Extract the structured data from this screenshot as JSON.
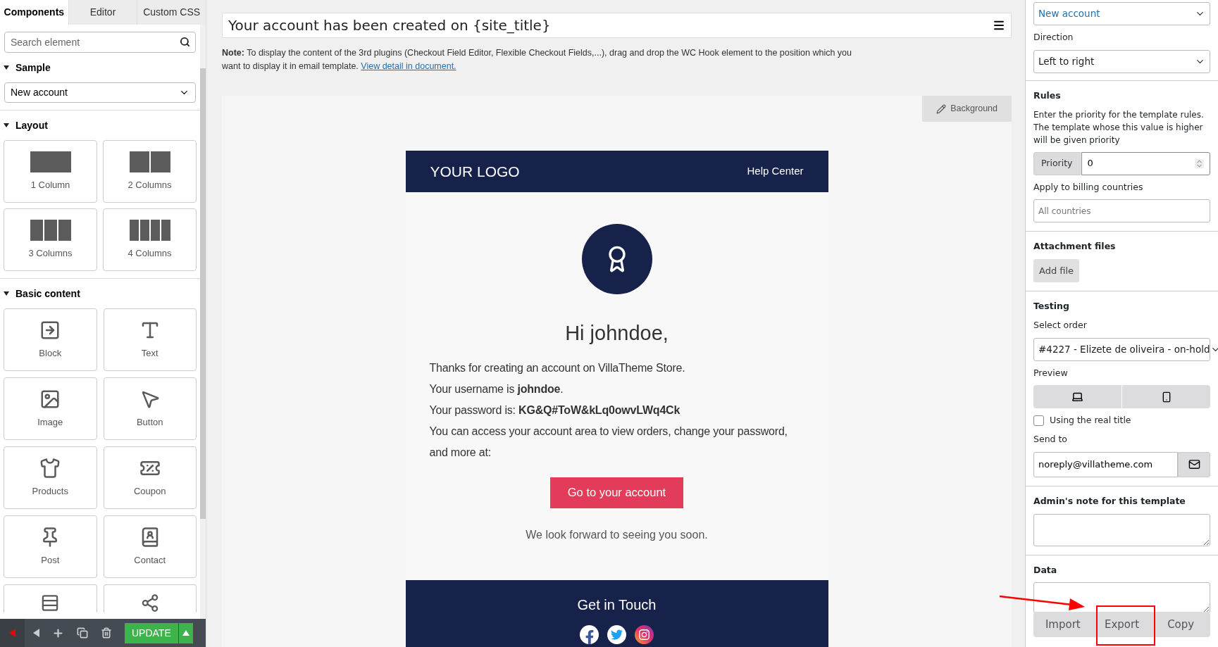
{
  "left_panel": {
    "tabs": [
      {
        "label": "Components",
        "selected": true
      },
      {
        "label": "Editor",
        "selected": false
      },
      {
        "label": "Custom CSS",
        "selected": false
      }
    ],
    "search": {
      "placeholder": "Search element"
    },
    "sample": {
      "heading": "Sample",
      "expanded": true,
      "value": "New account"
    },
    "layout": {
      "heading": "Layout",
      "expanded": true,
      "items": [
        {
          "label": "1 Column"
        },
        {
          "label": "2 Columns"
        },
        {
          "label": "3 Columns"
        },
        {
          "label": "4 Columns"
        }
      ]
    },
    "basic_content": {
      "heading": "Basic content",
      "expanded": true,
      "items": [
        {
          "label": "Block"
        },
        {
          "label": "Text"
        },
        {
          "label": "Image"
        },
        {
          "label": "Button"
        },
        {
          "label": "Products"
        },
        {
          "label": "Coupon"
        },
        {
          "label": "Post"
        },
        {
          "label": "Contact"
        },
        {
          "kind": "cut"
        },
        {
          "kind": "cut"
        }
      ]
    },
    "toolbar": {
      "update_label": "UPDATE"
    }
  },
  "center": {
    "title": "Your account has been created on {site_title}",
    "note": "**Note:** To display the content of the 3rd plugins (Checkout Field Editor, Flexible Checkout Fields,...), drag and drop the WC Hook element to the position which you want to display it in email template.",
    "note_link": "View detail in document.",
    "background_button": "Background",
    "email": {
      "logo": "YOUR LOGO",
      "help_link": "Help Center",
      "greeting": "Hi johndoe,",
      "lines": [
        "Thanks for creating an account on VillaTheme Store.",
        "Your username is **johndoe**.",
        "Your password is: **KG&Q#ToW&kLq0owvLWq4Ck**",
        "You can access your account area to view orders, change your password, and more at:"
      ],
      "cta": "Go to your account",
      "closing": "We look forward to seeing you soon.",
      "footer_title": "Get in Touch"
    }
  },
  "right_panel": {
    "template_select": "New account",
    "direction": {
      "label": "Direction",
      "value": "Left to right"
    },
    "rules": {
      "heading": "Rules",
      "description": "Enter the priority for the template rules. The template whose this value is higher will be given priority",
      "priority_label": "Priority",
      "priority_value": "0",
      "countries_label": "Apply to billing countries",
      "countries_placeholder": "All countries"
    },
    "attachments": {
      "heading": "Attachment files",
      "button": "Add file"
    },
    "testing": {
      "heading": "Testing",
      "order_label": "Select order",
      "order_value": "#4227 - Elizete de oliveira - on-hold",
      "preview_label": "Preview",
      "real_title": {
        "label": "Using the real title",
        "checked": false
      },
      "send_label": "Send to",
      "send_value": "noreply@villatheme.com"
    },
    "admin_note": {
      "heading": "Admin's note for this template"
    },
    "data": {
      "heading": "Data",
      "buttons": [
        "Import",
        "Export",
        "Copy"
      ]
    }
  }
}
